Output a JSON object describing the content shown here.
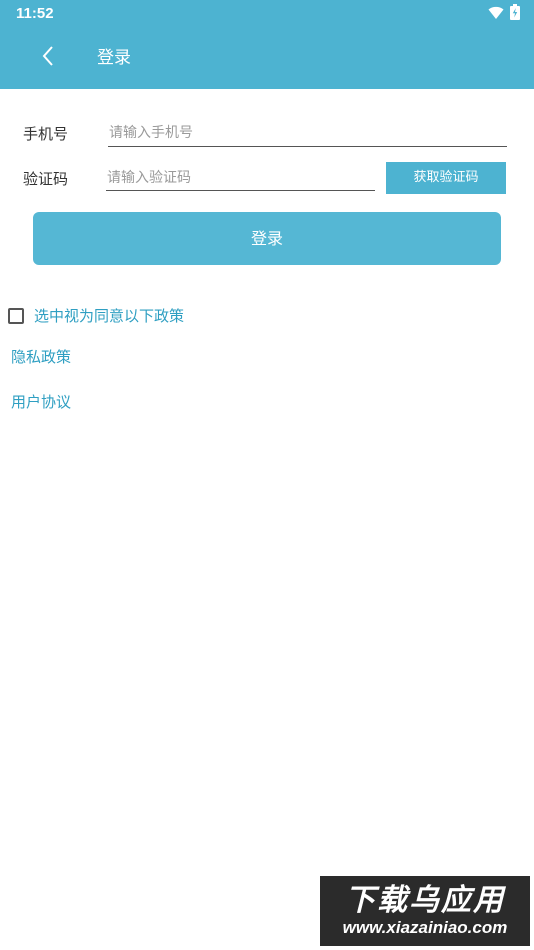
{
  "status_bar": {
    "time": "11:52",
    "wifi_icon": "wifi-icon",
    "battery_icon": "battery-charging-icon"
  },
  "header": {
    "back_icon": "chevron-left-icon",
    "title": "登录",
    "color": "#4db3d1"
  },
  "form": {
    "phone_label": "手机号",
    "phone_placeholder": "请输入手机号",
    "phone_value": "",
    "code_label": "验证码",
    "code_placeholder": "请输入验证码",
    "code_value": "",
    "get_code_label": "获取验证码",
    "login_label": "登录"
  },
  "agreement": {
    "checked": false,
    "text": "选中视为同意以下政策"
  },
  "links": {
    "privacy": "隐私政策",
    "terms": "用户协议"
  },
  "watermark": {
    "title": "下载乌应用",
    "url": "www.xiazainiao.com"
  },
  "colors": {
    "accent": "#4db3d1",
    "link": "#2f9fc2"
  }
}
